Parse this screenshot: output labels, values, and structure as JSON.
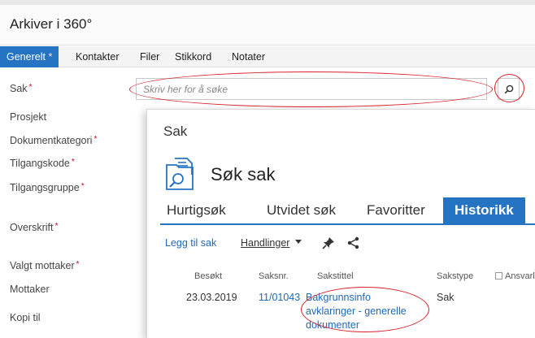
{
  "window": {
    "title": "Arkiver i 360°"
  },
  "tabs": [
    {
      "label": "Generelt",
      "required": "*"
    },
    {
      "label": "Kontakter"
    },
    {
      "label": "Filer"
    },
    {
      "label": "Stikkord"
    },
    {
      "label": "Notater"
    }
  ],
  "form": {
    "labels": [
      {
        "text": "Sak",
        "required": "*"
      },
      {
        "text": "Prosjekt"
      },
      {
        "text": "Dokumentkategori",
        "required": "*"
      },
      {
        "text": "Tilgangskode",
        "required": "*"
      },
      {
        "text": "Tilgangsgruppe",
        "required": "*"
      },
      {
        "text": "Overskrift",
        "required": "*"
      },
      {
        "text": "Valgt mottaker",
        "required": "*"
      },
      {
        "text": "Mottaker"
      },
      {
        "text": "Kopi til"
      }
    ],
    "sak_search": {
      "placeholder": "Skriv her for å søke",
      "value": "",
      "button_icon": "search-icon"
    }
  },
  "panel": {
    "title": "Sak",
    "heading": "Søk sak",
    "heading_icon": "document-search-icon",
    "tabs": [
      {
        "label": "Hurtigsøk"
      },
      {
        "label": "Utvidet søk"
      },
      {
        "label": "Favoritter"
      },
      {
        "label": "Historikk",
        "active": true
      }
    ],
    "toolbar": {
      "add_label": "Legg til sak",
      "actions_label": "Handlinger",
      "actions_icon": "caret-down-icon",
      "pin_icon": "pin-icon",
      "share_icon": "share-icon"
    },
    "table": {
      "columns": [
        "Besøkt",
        "Saksnr.",
        "Sakstittel",
        "Sakstype",
        "Ansvarl"
      ],
      "rows": [
        {
          "visited": "23.03.2019",
          "case_no": "11/01043",
          "title_lines": [
            "Bakgrunnsinfo",
            "avklaringer - generelle",
            "dokumenter"
          ],
          "type": "Sak"
        }
      ]
    }
  },
  "colors": {
    "accent": "#2574c4",
    "annotation": "#d9202a",
    "required": "#d0021b",
    "link": "#2168b8"
  }
}
